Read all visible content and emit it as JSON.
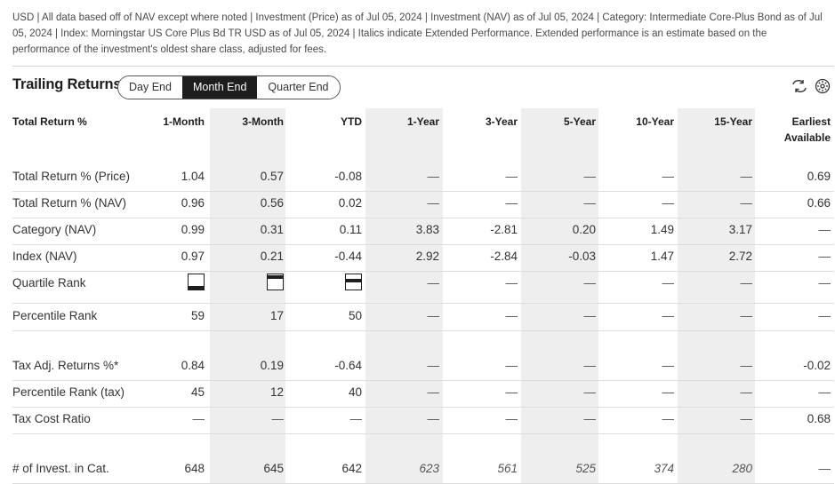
{
  "note": "USD | All data based off of NAV except where noted | Investment (Price) as of Jul 05, 2024 | Investment (NAV) as of Jul 05, 2024 | Category: Intermediate Core-Plus Bond as of Jul 05, 2024 | Index: Morningstar US Core Plus Bd TR USD as of Jul 05, 2024 | Italics indicate Extended Performance. Extended performance is an estimate based on the performance of the investment's oldest share class, adjusted for fees.",
  "title": "Trailing Returns",
  "segments": [
    "Day End",
    "Month End",
    "Quarter End"
  ],
  "active_segment": "Month End",
  "icons": [
    "refresh-icon",
    "settings-icon"
  ],
  "headers": [
    "Total Return %",
    "1-Month",
    "3-Month",
    "YTD",
    "1-Year",
    "3-Year",
    "5-Year",
    "10-Year",
    "15-Year",
    "Earliest Available"
  ],
  "rows": [
    {
      "label": "Total Return % (Price)",
      "cells": [
        "1.04",
        "0.57",
        "-0.08",
        "—",
        "—",
        "—",
        "—",
        "—",
        "0.69"
      ]
    },
    {
      "label": "Total Return % (NAV)",
      "cells": [
        "0.96",
        "0.56",
        "0.02",
        "—",
        "—",
        "—",
        "—",
        "—",
        "0.66"
      ]
    },
    {
      "label": "Category (NAV)",
      "cells": [
        "0.99",
        "0.31",
        "0.11",
        "3.83",
        "-2.81",
        "0.20",
        "1.49",
        "3.17",
        "—"
      ]
    },
    {
      "label": "Index (NAV)",
      "cells": [
        "0.97",
        "0.21",
        "-0.44",
        "2.92",
        "-2.84",
        "-0.03",
        "1.47",
        "2.72",
        "—"
      ]
    },
    {
      "label": "Quartile Rank",
      "cells": [
        "quartile-4",
        "quartile-1",
        "quartile-2",
        "—",
        "—",
        "—",
        "—",
        "—",
        "—"
      ]
    },
    {
      "label": "Percentile Rank",
      "cells": [
        "59",
        "17",
        "50",
        "—",
        "—",
        "—",
        "—",
        "—",
        "—"
      ]
    },
    {
      "label": "Tax Adj. Returns %*",
      "cells": [
        "0.84",
        "0.19",
        "-0.64",
        "—",
        "—",
        "—",
        "—",
        "—",
        "-0.02"
      ]
    },
    {
      "label": "Percentile Rank (tax)",
      "cells": [
        "45",
        "12",
        "40",
        "—",
        "—",
        "—",
        "—",
        "—",
        "—"
      ]
    },
    {
      "label": "Tax Cost Ratio",
      "cells": [
        "—",
        "—",
        "—",
        "—",
        "—",
        "—",
        "—",
        "—",
        "0.68"
      ]
    },
    {
      "label": "# of Invest. in Cat.",
      "cells": [
        "648",
        "645",
        "642",
        "623",
        "561",
        "525",
        "374",
        "280",
        "—"
      ],
      "italic_cols": [
        3,
        4,
        5,
        6,
        7
      ]
    }
  ],
  "quartile_levels": {
    "quartile-1": 1,
    "quartile-2": 2,
    "quartile-4": 4
  }
}
